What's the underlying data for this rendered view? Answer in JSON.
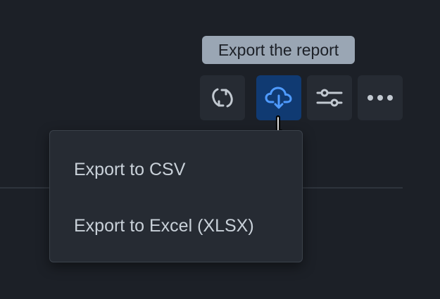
{
  "tooltip": {
    "text": "Export the report"
  },
  "toolbar": {
    "buttons": [
      {
        "name": "refresh",
        "icon": "refresh-icon"
      },
      {
        "name": "export",
        "icon": "cloud-download-icon",
        "active": true
      },
      {
        "name": "filter",
        "icon": "sliders-icon"
      },
      {
        "name": "more",
        "icon": "ellipsis-icon"
      }
    ]
  },
  "export_menu": {
    "items": [
      {
        "label": "Export to CSV"
      },
      {
        "label": "Export to Excel (XLSX)"
      }
    ]
  },
  "colors": {
    "background": "#1c2027",
    "button_bg": "#262b33",
    "active_button_bg": "#103a72",
    "accent": "#4f9bff",
    "icon": "#c2c9d1",
    "tooltip_bg": "#9aa6b4",
    "menu_text": "#c9d1d9"
  }
}
